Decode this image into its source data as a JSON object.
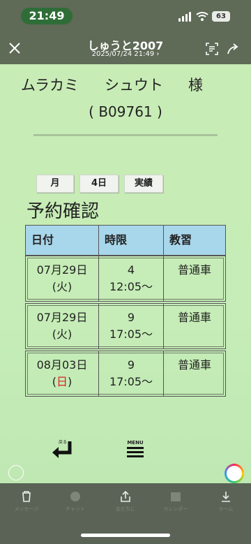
{
  "status_bar": {
    "time": "21:49",
    "battery": "63"
  },
  "header": {
    "title": "しゅうと2007",
    "subtitle": "2025/07/24 21:49 ›"
  },
  "student": {
    "surname": "ムラカミ",
    "given_name": "シュウト",
    "honorific": "様",
    "id": "( B09761 )"
  },
  "chips": {
    "month": "月",
    "day4": "4日",
    "record": "実績"
  },
  "section_title": "予約確認",
  "table": {
    "headers": [
      "日付",
      "時限",
      "教習"
    ],
    "rows": [
      {
        "date": "07月29日",
        "weekday": "(火)",
        "weekday_red": false,
        "period": "4",
        "time": "12:05～",
        "lesson": "普通車"
      },
      {
        "date": "07月29日",
        "weekday": "(火)",
        "weekday_red": false,
        "period": "9",
        "time": "17:05～",
        "lesson": "普通車"
      },
      {
        "date": "08月03日",
        "weekday_open": "(",
        "weekday_char": "日",
        "weekday_close": ")",
        "weekday_red": true,
        "period": "9",
        "time": "17:05～",
        "lesson": "普通車"
      }
    ]
  },
  "nav": {
    "back_label": "戻る",
    "menu_label": "MENU"
  },
  "bottom_tabs": [
    "メッセージ",
    "チャット",
    "友だちに",
    "カレンダー",
    "ホーム"
  ],
  "colors": {
    "content_bg": "#c8ecb6",
    "table_header": "#a8d6ea",
    "sunday_red": "#d22"
  }
}
